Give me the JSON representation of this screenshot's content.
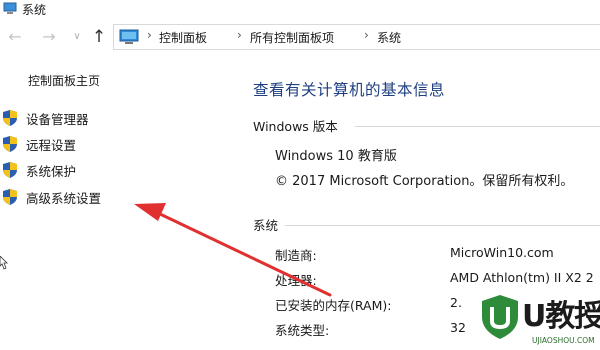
{
  "window": {
    "title": "系统"
  },
  "nav": {
    "back_icon": "arrow-left-icon",
    "forward_icon": "arrow-right-icon",
    "up_icon": "arrow-up-icon",
    "breadcrumb": [
      "控制面板",
      "所有控制面板项",
      "系统"
    ]
  },
  "sidebar": {
    "home": "控制面板主页",
    "items": [
      {
        "label": "设备管理器",
        "icon": "shield-icon"
      },
      {
        "label": "远程设置",
        "icon": "shield-icon"
      },
      {
        "label": "系统保护",
        "icon": "shield-icon"
      },
      {
        "label": "高级系统设置",
        "icon": "shield-icon"
      }
    ]
  },
  "main": {
    "title": "查看有关计算机的基本信息",
    "windows_section": {
      "heading": "Windows 版本",
      "edition": "Windows 10 教育版",
      "copyright": "© 2017 Microsoft Corporation。保留所有权利。"
    },
    "system_section": {
      "heading": "系统",
      "rows": [
        {
          "label": "制造商:",
          "value": "MicroWin10.com"
        },
        {
          "label": "处理器:",
          "value": "AMD Athlon(tm) II X2 2"
        },
        {
          "label": "已安装的内存(RAM):",
          "value": "2."
        },
        {
          "label": "系统类型:",
          "value": "32"
        }
      ]
    }
  },
  "watermark": {
    "text": "U教授",
    "sub": "UJIAOSHOU.COM"
  },
  "colors": {
    "title_blue": "#1e3f80",
    "arrow_red": "#e03030",
    "shield_blue": "#2a5fb0",
    "shield_yellow": "#f2c21a"
  }
}
